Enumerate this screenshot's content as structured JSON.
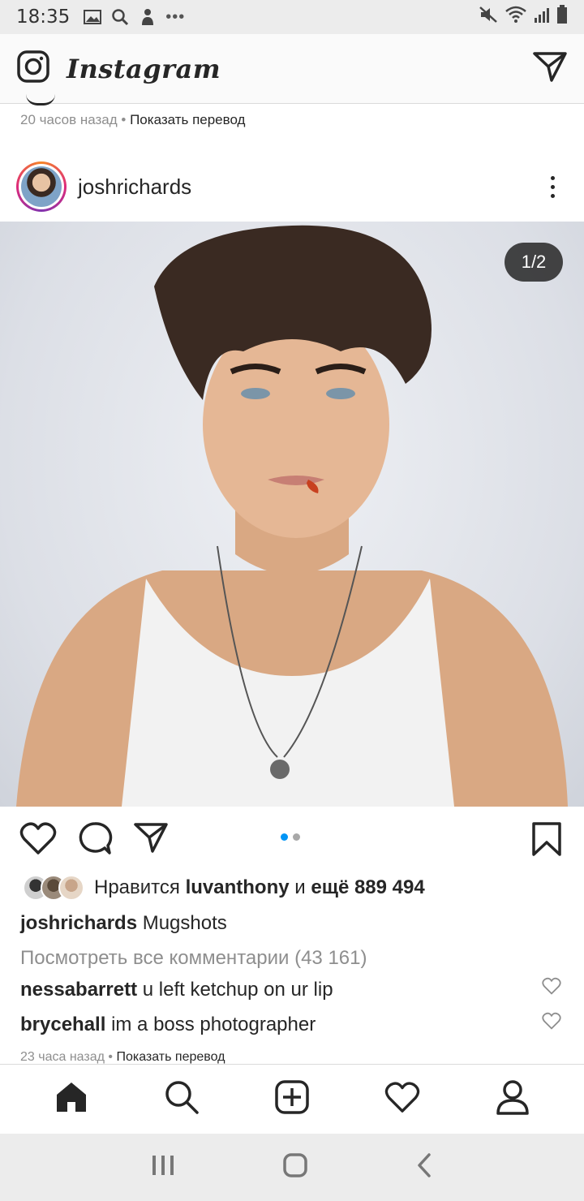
{
  "status_bar": {
    "time": "18:35",
    "more": "•••"
  },
  "app_bar": {
    "title": "Instagram"
  },
  "previous_post": {
    "time_ago": "20 часов назад",
    "separator": " • ",
    "translate": "Показать перевод"
  },
  "post": {
    "username": "joshrichards",
    "carousel_counter": "1/2",
    "carousel": {
      "current": 1,
      "total": 2
    },
    "likes": {
      "prefix": "Нравится",
      "user": "luvanthony",
      "middle": "и",
      "count": "ещё 889 494"
    },
    "caption": {
      "user": "joshrichards",
      "text": "Mugshots"
    },
    "view_comments": "Посмотреть все комментарии (43 161)",
    "comments": [
      {
        "user": "nessabarrett",
        "text": "u left ketchup on ur lip"
      },
      {
        "user": "brycehall",
        "text": "im a boss photographer"
      }
    ],
    "time_ago": "23 часа назад",
    "separator": " • ",
    "translate": "Показать перевод"
  },
  "colors": {
    "accent": "#0095f6",
    "text": "#262626",
    "muted": "#8e8e8e"
  }
}
